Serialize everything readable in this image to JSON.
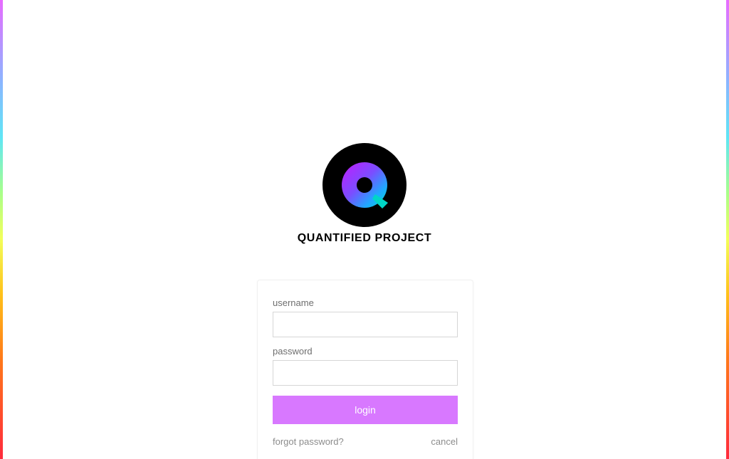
{
  "brand": {
    "name": "QUANTIFIED PROJECT",
    "logo_icon": "q-circle-logo-icon"
  },
  "login_form": {
    "username_label": "username",
    "username_value": "",
    "password_label": "password",
    "password_value": "",
    "login_label": "login",
    "forgot_label": "forgot password?",
    "cancel_label": "cancel"
  },
  "colors": {
    "accent": "#d878ff",
    "edge_gradient": [
      "#e86bff",
      "#8ab6ff",
      "#5fe6f5",
      "#a8ff8a",
      "#f2ff5a",
      "#ffc21a",
      "#ff7a1a",
      "#ff2a3c"
    ]
  }
}
